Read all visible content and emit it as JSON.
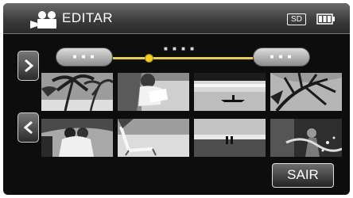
{
  "header": {
    "mode_icon": "video-camera-icon",
    "title": "EDITAR",
    "media_badge": "SD",
    "battery_icon": "battery-icon"
  },
  "navigation": {
    "next_icon": "chevron-right-icon",
    "prev_icon": "chevron-left-icon"
  },
  "timeline": {
    "start_label": "■ ■ ■",
    "end_label": "■ ■ ■",
    "time_label": "■ ■ ■ ■"
  },
  "thumbnails": [
    {
      "label": "palm-trees-beach"
    },
    {
      "label": "person-reading-beach"
    },
    {
      "label": "canoe-on-lake"
    },
    {
      "label": "palm-leaves-sky"
    },
    {
      "label": "couple-palm-trees"
    },
    {
      "label": "beach-lounge-chair"
    },
    {
      "label": "couple-on-beach-sunset"
    },
    {
      "label": "woman-splashing-water"
    }
  ],
  "footer": {
    "exit_label": "SAIR"
  },
  "colors": {
    "accent_yellow": "#e6d23a",
    "background": "#0d0d0d"
  }
}
